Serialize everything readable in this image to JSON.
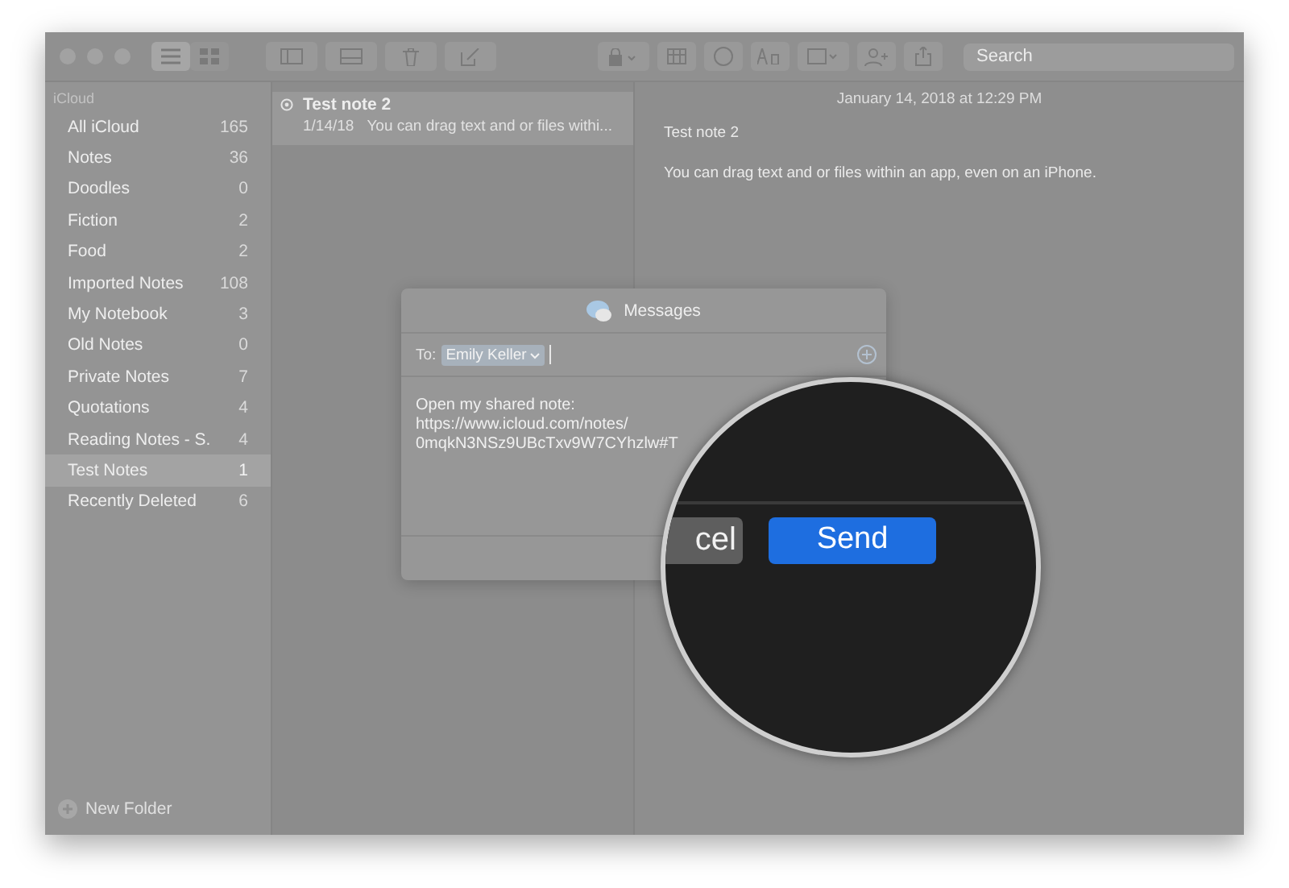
{
  "toolbar": {
    "views": [
      {
        "kind": "list",
        "selected": true
      },
      {
        "kind": "grid",
        "selected": false
      }
    ],
    "search": {
      "placeholder": "Search"
    }
  },
  "sidebar": {
    "section": "iCloud",
    "items": [
      {
        "label": "All iCloud",
        "count": "165",
        "selected": false
      },
      {
        "label": "Notes",
        "count": "36",
        "selected": false
      },
      {
        "label": "Doodles",
        "count": "0",
        "selected": false
      },
      {
        "label": "Fiction",
        "count": "2",
        "selected": false
      },
      {
        "label": "Food",
        "count": "2",
        "selected": false
      },
      {
        "label": "Imported Notes",
        "count": "108",
        "selected": false
      },
      {
        "label": "My Notebook",
        "count": "3",
        "selected": false
      },
      {
        "label": "Old Notes",
        "count": "0",
        "selected": false
      },
      {
        "label": "Private Notes",
        "count": "7",
        "selected": false
      },
      {
        "label": "Quotations",
        "count": "4",
        "selected": false
      },
      {
        "label": "Reading Notes - S.",
        "count": "4",
        "selected": false
      },
      {
        "label": "Test Notes",
        "count": "1",
        "selected": true
      },
      {
        "label": "Recently Deleted",
        "count": "6",
        "selected": false
      }
    ],
    "new_folder": "New Folder"
  },
  "notes": [
    {
      "title": "Test note 2",
      "date": "1/14/18",
      "snippet": "You can drag text and or files withi...",
      "selected": true
    }
  ],
  "detail": {
    "timestamp": "January 14, 2018 at 12:29 PM",
    "title": "Test note 2",
    "body": "You can drag text and or files within an app, even on an iPhone."
  },
  "dialog": {
    "title": "Messages",
    "to_label": "To:",
    "recipient": "Emily Keller",
    "message": [
      "Open my shared note:",
      "https://www.icloud.com/notes/",
      "0mqkN3NSz9UBcTxv9W7CYhzlw#T"
    ]
  },
  "magnifier": {
    "cancel": "cel",
    "send": "Send"
  }
}
